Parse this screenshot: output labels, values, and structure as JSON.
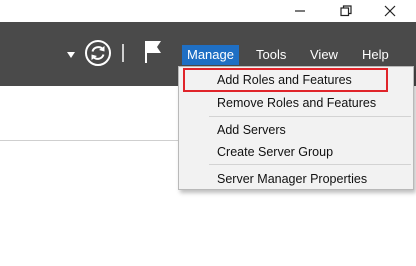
{
  "window_controls": {
    "minimize_icon": "minimize-icon",
    "maximize_icon": "restore-icon",
    "close_icon": "close-icon"
  },
  "toolbar": {
    "menu": [
      {
        "label": "Manage"
      },
      {
        "label": "Tools"
      },
      {
        "label": "View"
      },
      {
        "label": "Help"
      }
    ],
    "icons": [
      "dropdown-arrow-icon",
      "refresh-icon",
      "flag-icon"
    ],
    "colors": {
      "background": "#4a4a4a",
      "active_menu": "#1f6fc4",
      "highlight_box": "#e0242a"
    }
  },
  "manage_menu": {
    "items": [
      {
        "label": "Add Roles and Features"
      },
      {
        "label": "Remove Roles and Features"
      },
      {
        "label": "Add Servers"
      },
      {
        "label": "Create Server Group"
      },
      {
        "label": "Server Manager Properties"
      }
    ]
  }
}
